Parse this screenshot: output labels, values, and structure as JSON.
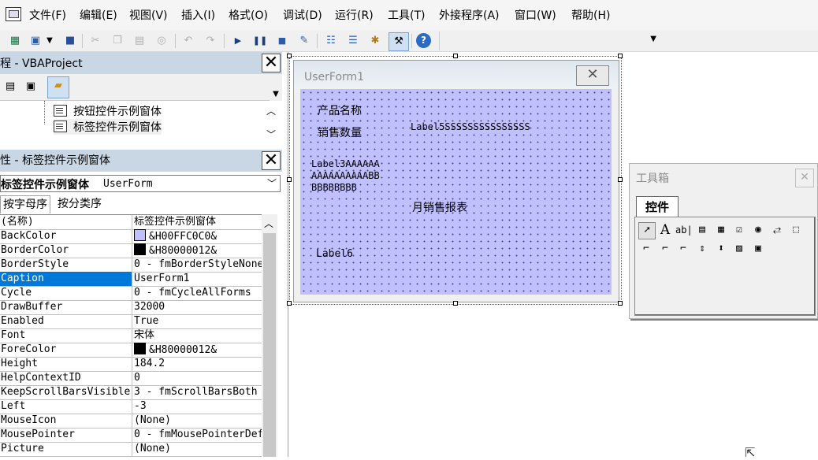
{
  "menubar": {
    "items": [
      "文件(F)",
      "编辑(E)",
      "视图(V)",
      "插入(I)",
      "格式(O)",
      "调试(D)",
      "运行(R)",
      "工具(T)",
      "外接程序(A)",
      "窗口(W)",
      "帮助(H)"
    ]
  },
  "toolbar": {
    "icons": [
      "excel-icon",
      "insert-userform-icon",
      "dropdown-icon",
      "save-icon",
      "cut-icon",
      "copy-icon",
      "paste-icon",
      "find-icon",
      "undo-icon",
      "redo-icon",
      "run-icon",
      "break-icon",
      "reset-icon",
      "design-mode-icon",
      "project-explorer-icon",
      "properties-icon",
      "object-browser-icon",
      "toolbox-icon",
      "help-icon"
    ]
  },
  "project": {
    "title": "工程 - VBAProject",
    "items": [
      "按钮控件示例窗体",
      "标签控件示例窗体"
    ],
    "selected_index": 1
  },
  "properties": {
    "title": "属性 - 标签控件示例窗体",
    "object_name": "标签控件示例窗体",
    "object_type": "UserForm",
    "tabs": [
      "按字母序",
      "按分类序"
    ],
    "active_tab": 0,
    "rows": [
      {
        "name": "(名称)",
        "value": "标签控件示例窗体"
      },
      {
        "name": "BackColor",
        "value": "&H00FFC0C0&",
        "swatch": "#c0c0ff"
      },
      {
        "name": "BorderColor",
        "value": "&H80000012&",
        "swatch": "#000000"
      },
      {
        "name": "BorderStyle",
        "value": "0 - fmBorderStyleNone"
      },
      {
        "name": "Caption",
        "value": "UserForm1",
        "selected": true
      },
      {
        "name": "Cycle",
        "value": "0 - fmCycleAllForms"
      },
      {
        "name": "DrawBuffer",
        "value": "32000"
      },
      {
        "name": "Enabled",
        "value": "True"
      },
      {
        "name": "Font",
        "value": "宋体"
      },
      {
        "name": "ForeColor",
        "value": "&H80000012&",
        "swatch": "#000000"
      },
      {
        "name": "Height",
        "value": "184.2"
      },
      {
        "name": "HelpContextID",
        "value": "0"
      },
      {
        "name": "KeepScrollBarsVisible",
        "value": "3 - fmScrollBarsBoth"
      },
      {
        "name": "Left",
        "value": "-3"
      },
      {
        "name": "MouseIcon",
        "value": "(None)"
      },
      {
        "name": "MousePointer",
        "value": "0 - fmMousePointerDefault"
      },
      {
        "name": "Picture",
        "value": "(None)"
      }
    ]
  },
  "userform": {
    "title": "UserForm1",
    "back_color": "#c0c0ff",
    "labels": {
      "product_name": "产品名称",
      "sales_qty": "销售数量",
      "label5": "Label5SSSSSSSSSSSSSSS",
      "label3_lines": [
        "Label3AAAAAA",
        "AAAAAAAAAABB",
        "BBBBBBBB"
      ],
      "monthly_report": "月销售报表",
      "label6": "Label6"
    }
  },
  "toolbox": {
    "title": "工具箱",
    "tab": "控件",
    "tools_row1": [
      "select-objects-icon",
      "label-tool-icon",
      "textbox-tool-icon",
      "combobox-tool-icon",
      "listbox-tool-icon",
      "checkbox-tool-icon",
      "optionbutton-tool-icon",
      "togglebutton-tool-icon",
      "frame-tool-icon"
    ],
    "tools_row2": [
      "commandbutton-tool-icon",
      "tabstrip-tool-icon",
      "multipage-tool-icon",
      "scrollbar-tool-icon",
      "spinbutton-tool-icon",
      "image-tool-icon",
      "refedit-tool-icon"
    ]
  }
}
